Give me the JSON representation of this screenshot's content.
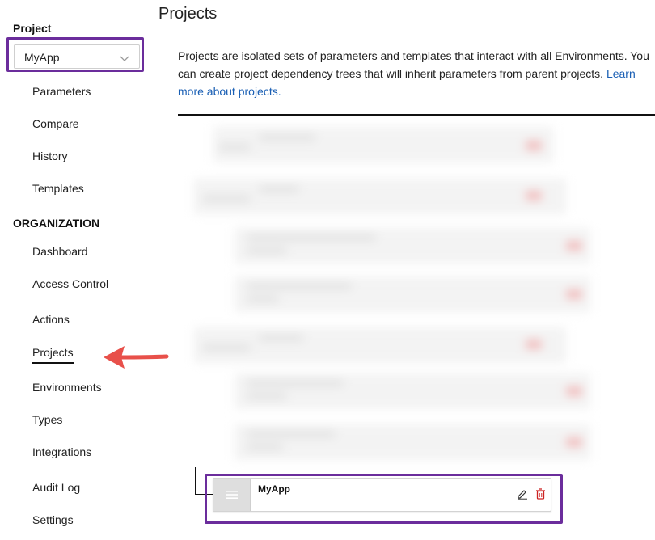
{
  "sidebar": {
    "project_heading": "Project",
    "project_select": {
      "value": "MyApp"
    },
    "project_items": [
      {
        "label": "Parameters"
      },
      {
        "label": "Compare"
      },
      {
        "label": "History"
      },
      {
        "label": "Templates"
      }
    ],
    "organization_heading": "ORGANIZATION",
    "org_items": [
      {
        "label": "Dashboard"
      },
      {
        "label": "Access Control"
      },
      {
        "label": "Actions"
      },
      {
        "label": "Projects",
        "active": true
      },
      {
        "label": "Environments"
      },
      {
        "label": "Types"
      },
      {
        "label": "Integrations"
      },
      {
        "label": "Audit Log"
      },
      {
        "label": "Settings"
      }
    ]
  },
  "main": {
    "title": "Projects",
    "description": "Projects are isolated sets of parameters and templates that interact with all Environments. You can create project dependency trees that will inherit parameters from parent projects.",
    "learn_more_link": "Learn more about projects.",
    "project_card": {
      "name": "MyApp",
      "edit_icon": "pencil-icon",
      "delete_icon": "trash-icon"
    }
  },
  "colors": {
    "highlight": "#6b2d9c",
    "link": "#1a5fb4",
    "arrow": "#e8504a",
    "delete": "#cc2222"
  }
}
